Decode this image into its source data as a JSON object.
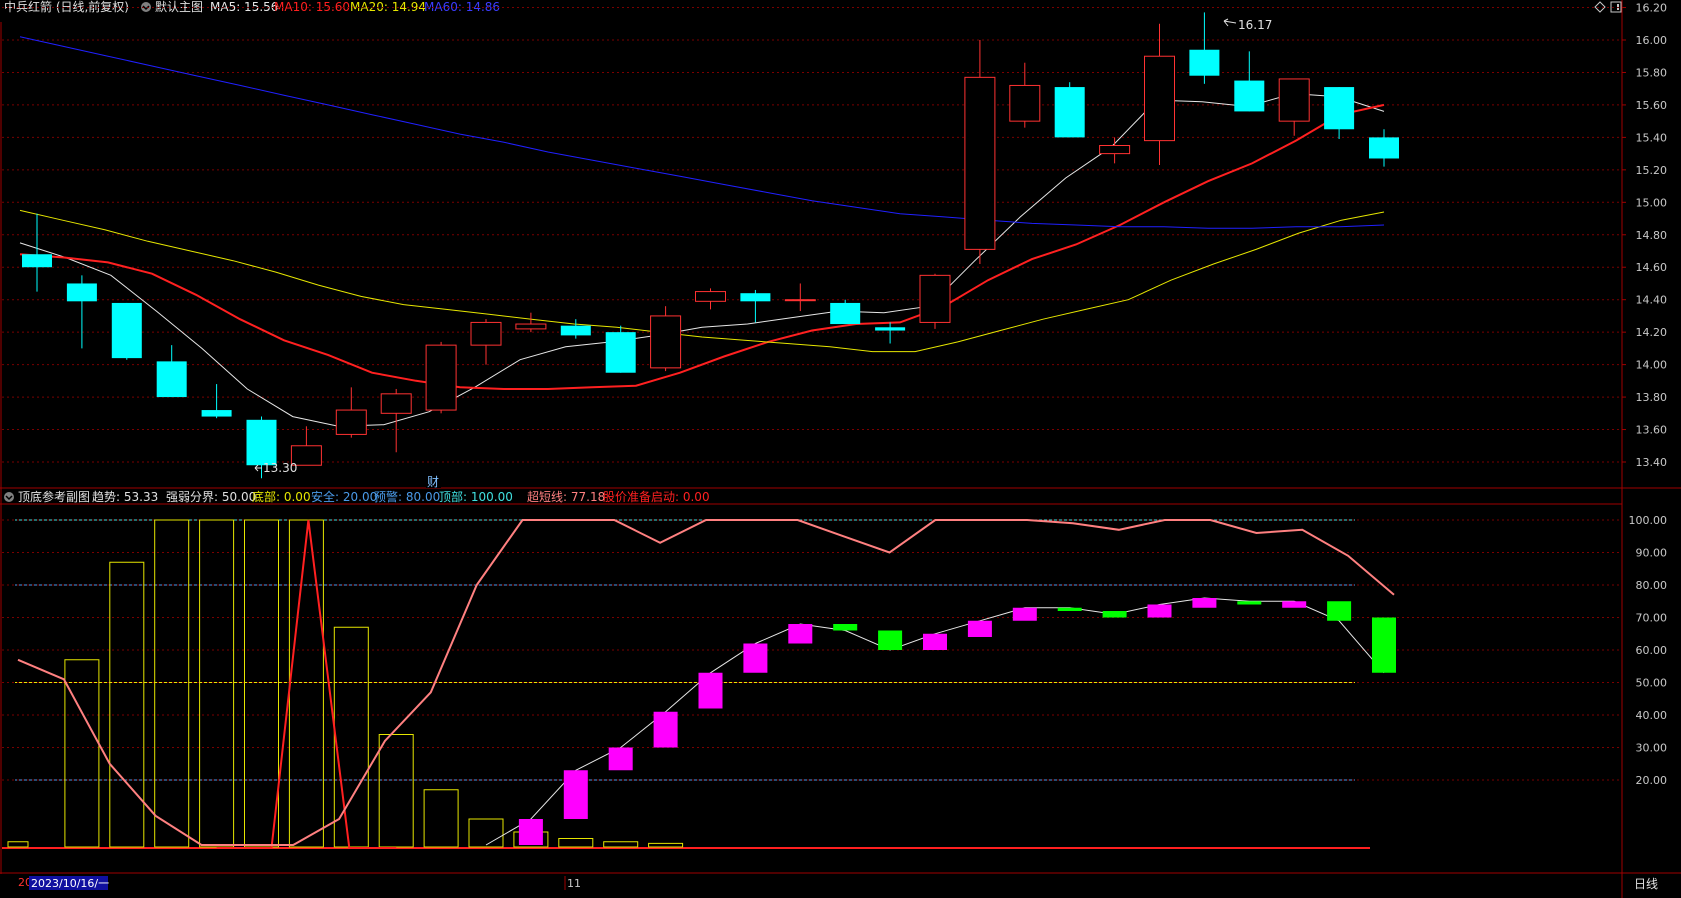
{
  "colors": {
    "up": "#ff3232",
    "down": "#00ffff",
    "ma5": "#e6e6e6",
    "ma10": "#ff2020",
    "ma20": "#e6e600",
    "ma60": "#2020ff",
    "grid": "#7a0000",
    "frame": "#a00000",
    "axis_text": "#c8c8c8",
    "sub_up": "#ff00ff",
    "sub_down": "#00ff00",
    "bars": "#e6e600",
    "super": "#ff8080",
    "weak": "#e6e600",
    "top_line": "#40e0e0",
    "warn_line": "#4a9ae8",
    "safe_line": "#4a9ae8",
    "bottom_red": "#ff2020"
  },
  "main_header": {
    "stock": "中兵红箭 (日线,前复权)",
    "chart_label": "默认主图",
    "ma5": "MA5: 15.56",
    "ma10": "MA10: 15.60",
    "ma20": "MA20: 14.94",
    "ma60": "MA60: 14.86"
  },
  "sub_header": {
    "title": "顶底参考副图",
    "trend": "趋势: 53.33",
    "divide": "强弱分界: 50.00",
    "bottom": "底部: 0.00",
    "safe": "安全: 20.00",
    "warn": "预警: 80.00",
    "top": "顶部: 100.00",
    "super_short": "超短线: 77.18",
    "start": "股价准备启动: 0.00"
  },
  "annotations": {
    "high": "16.17",
    "low": "13.30",
    "finance_marker": "财"
  },
  "footer": {
    "year_prefix": "20",
    "date": "2023/10/16/一",
    "month": "11",
    "period": "日线"
  },
  "chart_data": [
    {
      "type": "candlestick",
      "ylim": [
        13.3,
        16.3
      ],
      "y_ticks": [
        "16.20",
        "16.00",
        "15.80",
        "15.60",
        "15.40",
        "15.20",
        "15.00",
        "14.80",
        "14.60",
        "14.40",
        "14.20",
        "14.00",
        "13.80",
        "13.60",
        "13.40"
      ],
      "candles": [
        {
          "o": 14.68,
          "c": 14.6,
          "h": 14.93,
          "l": 14.45
        },
        {
          "o": 14.5,
          "c": 14.39,
          "h": 14.55,
          "l": 14.1
        },
        {
          "o": 14.38,
          "c": 14.04,
          "h": 14.38,
          "l": 14.03
        },
        {
          "o": 14.02,
          "c": 13.8,
          "h": 14.12,
          "l": 13.8
        },
        {
          "o": 13.72,
          "c": 13.68,
          "h": 13.88,
          "l": 13.67
        },
        {
          "o": 13.66,
          "c": 13.38,
          "h": 13.68,
          "l": 13.3
        },
        {
          "o": 13.38,
          "c": 13.5,
          "h": 13.62,
          "l": 13.38
        },
        {
          "o": 13.57,
          "c": 13.72,
          "h": 13.86,
          "l": 13.55
        },
        {
          "o": 13.7,
          "c": 13.82,
          "h": 13.85,
          "l": 13.46
        },
        {
          "o": 13.72,
          "c": 14.12,
          "h": 14.14,
          "l": 13.7
        },
        {
          "o": 14.12,
          "c": 14.26,
          "h": 14.28,
          "l": 14.0
        },
        {
          "o": 14.22,
          "c": 14.25,
          "h": 14.32,
          "l": 14.2
        },
        {
          "o": 14.24,
          "c": 14.18,
          "h": 14.28,
          "l": 14.16
        },
        {
          "o": 14.2,
          "c": 13.95,
          "h": 14.24,
          "l": 13.95
        },
        {
          "o": 13.98,
          "c": 14.3,
          "h": 14.36,
          "l": 13.96
        },
        {
          "o": 14.39,
          "c": 14.45,
          "h": 14.47,
          "l": 14.34
        },
        {
          "o": 14.44,
          "c": 14.39,
          "h": 14.46,
          "l": 14.26
        },
        {
          "o": 14.4,
          "c": 14.4,
          "h": 14.5,
          "l": 14.33
        },
        {
          "o": 14.38,
          "c": 14.25,
          "h": 14.4,
          "l": 14.25
        },
        {
          "o": 14.23,
          "c": 14.21,
          "h": 14.26,
          "l": 14.13
        },
        {
          "o": 14.26,
          "c": 14.55,
          "h": 14.56,
          "l": 14.22
        },
        {
          "o": 14.71,
          "c": 15.77,
          "h": 16.0,
          "l": 14.62
        },
        {
          "o": 15.5,
          "c": 15.72,
          "h": 15.86,
          "l": 15.46
        },
        {
          "o": 15.71,
          "c": 15.4,
          "h": 15.74,
          "l": 15.4
        },
        {
          "o": 15.3,
          "c": 15.35,
          "h": 15.4,
          "l": 15.24
        },
        {
          "o": 15.38,
          "c": 15.9,
          "h": 16.1,
          "l": 15.23
        },
        {
          "o": 15.94,
          "c": 15.78,
          "h": 16.17,
          "l": 15.73
        },
        {
          "o": 15.75,
          "c": 15.56,
          "h": 15.93,
          "l": 15.56
        },
        {
          "o": 15.5,
          "c": 15.76,
          "h": 15.76,
          "l": 15.41
        },
        {
          "o": 15.71,
          "c": 15.45,
          "h": 15.71,
          "l": 15.39
        },
        {
          "o": 15.4,
          "c": 15.27,
          "h": 15.45,
          "l": 15.22
        }
      ],
      "series": [
        {
          "name": "MA5",
          "values": [
            14.75,
            14.66,
            14.55,
            14.33,
            14.1,
            13.85,
            13.68,
            13.62,
            13.63,
            13.71,
            13.86,
            14.03,
            14.11,
            14.14,
            14.18,
            14.23,
            14.25,
            14.29,
            14.33,
            14.32,
            14.36,
            14.64,
            14.91,
            15.15,
            15.34,
            15.63,
            15.62,
            15.59,
            15.67,
            15.65,
            15.56
          ]
        },
        {
          "name": "MA10",
          "values": [
            14.68,
            14.66,
            14.63,
            14.56,
            14.43,
            14.28,
            14.15,
            14.06,
            13.95,
            13.9,
            13.86,
            13.85,
            13.85,
            13.86,
            13.87,
            13.95,
            14.05,
            14.14,
            14.21,
            14.25,
            14.26,
            14.36,
            14.52,
            14.65,
            14.74,
            14.86,
            15.0,
            15.13,
            15.24,
            15.38,
            15.54,
            15.6
          ]
        },
        {
          "name": "MA20",
          "values": [
            14.95,
            14.89,
            14.83,
            14.76,
            14.7,
            14.64,
            14.57,
            14.49,
            14.42,
            14.37,
            14.34,
            14.31,
            14.28,
            14.25,
            14.23,
            14.2,
            14.17,
            14.15,
            14.13,
            14.11,
            14.08,
            14.08,
            14.14,
            14.21,
            14.28,
            14.34,
            14.4,
            14.52,
            14.62,
            14.71,
            14.81,
            14.89,
            14.94
          ]
        },
        {
          "name": "MA60",
          "values": [
            16.02,
            15.96,
            15.9,
            15.84,
            15.78,
            15.72,
            15.66,
            15.6,
            15.54,
            15.48,
            15.42,
            15.37,
            15.31,
            15.26,
            15.21,
            15.16,
            15.11,
            15.06,
            15.01,
            14.97,
            14.93,
            14.91,
            14.89,
            14.87,
            14.86,
            14.85,
            14.85,
            14.84,
            14.84,
            14.85,
            14.85,
            14.86
          ]
        }
      ]
    },
    {
      "type": "bar",
      "ylim": [
        0,
        105
      ],
      "y_ticks": [
        "100.00",
        "90.00",
        "80.00",
        "70.00",
        "60.00",
        "50.00",
        "40.00",
        "30.00",
        "20.00"
      ],
      "levels": [
        100,
        80,
        50,
        20
      ],
      "yellow_bars": [
        1,
        57,
        87,
        100,
        100,
        100,
        100,
        67,
        34,
        17,
        8,
        4,
        2,
        1,
        0.5
      ],
      "trend_boxes": [
        {
          "a": 8,
          "b": 0,
          "up": true
        },
        {
          "a": 23,
          "b": 8,
          "up": true
        },
        {
          "a": 30,
          "b": 23,
          "up": true
        },
        {
          "a": 41,
          "b": 30,
          "up": true
        },
        {
          "a": 53,
          "b": 42,
          "up": true
        },
        {
          "a": 62,
          "b": 53,
          "up": true
        },
        {
          "a": 68,
          "b": 62,
          "up": true
        },
        {
          "a": 68,
          "b": 66,
          "up": false
        },
        {
          "a": 66,
          "b": 60,
          "up": false
        },
        {
          "a": 65,
          "b": 60,
          "up": true
        },
        {
          "a": 69,
          "b": 64,
          "up": true
        },
        {
          "a": 73,
          "b": 69,
          "up": true
        },
        {
          "a": 73,
          "b": 72,
          "up": false
        },
        {
          "a": 72,
          "b": 70,
          "up": false
        },
        {
          "a": 74,
          "b": 70,
          "up": true
        },
        {
          "a": 76,
          "b": 73,
          "up": true
        },
        {
          "a": 75,
          "b": 74,
          "up": false
        },
        {
          "a": 75,
          "b": 73,
          "up": true
        },
        {
          "a": 75,
          "b": 69,
          "up": false
        },
        {
          "a": 70,
          "b": 53,
          "up": false
        }
      ],
      "series": [
        {
          "name": "超短线",
          "values": [
            57,
            51,
            25,
            9,
            0,
            0,
            0,
            8,
            32,
            47,
            80,
            100,
            100,
            100,
            93,
            100,
            100,
            100,
            95,
            90,
            100,
            100,
            100,
            99,
            97,
            100,
            100,
            96,
            97,
            89,
            77
          ]
        },
        {
          "name": "趋势",
          "values": [
            0,
            8,
            23,
            30,
            41,
            53,
            62,
            68,
            66,
            60,
            65,
            69,
            73,
            73,
            71,
            74,
            76,
            75,
            75,
            69,
            53
          ]
        }
      ]
    }
  ]
}
